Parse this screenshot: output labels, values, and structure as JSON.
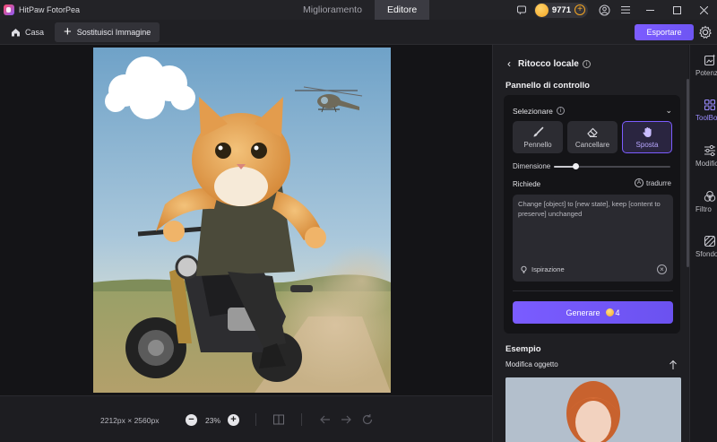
{
  "app": {
    "name": "HitPaw FotorPea"
  },
  "tabs": [
    {
      "label": "Miglioramento",
      "active": false
    },
    {
      "label": "Editore",
      "active": true
    }
  ],
  "titlebar": {
    "coins": "9771"
  },
  "toolbar": {
    "home_label": "Casa",
    "replace_label": "Sostituisci Immagine",
    "export_label": "Esportare"
  },
  "bottom": {
    "dimensions": "2212px × 2560px",
    "zoom": "23%"
  },
  "panel": {
    "header": "Ritocco locale",
    "control_title": "Pannello di controllo",
    "select_label": "Selezionare",
    "tools": [
      {
        "label": "Pennello",
        "icon": "brush-icon",
        "active": false
      },
      {
        "label": "Cancellare",
        "icon": "eraser-icon",
        "active": false
      },
      {
        "label": "Sposta",
        "icon": "hand-icon",
        "active": true
      }
    ],
    "dimension_label": "Dimensione",
    "dimension_value": 0.19,
    "requests_label": "Richiede",
    "translate_label": "tradurre",
    "prompt_text": "Change [object] to [new state], keep [content to preserve] unchanged",
    "inspiration_label": "Ispirazione",
    "generate_label": "Generare",
    "generate_cost": "4",
    "example_title": "Esempio",
    "example_subtitle": "Modifica oggetto"
  },
  "sidebar": [
    {
      "label": "Potenziamento",
      "icon": "enhance-icon",
      "active": false
    },
    {
      "label": "ToolBox",
      "icon": "toolbox-icon",
      "active": true
    },
    {
      "label": "Modifica",
      "icon": "adjust-icon",
      "active": false
    },
    {
      "label": "Filtro",
      "icon": "filter-icon",
      "active": false
    },
    {
      "label": "Sfondo",
      "icon": "background-icon",
      "active": false
    }
  ],
  "colors": {
    "accent": "#7c5cff",
    "background": "#1b1b1f",
    "panel": "#1f1f23"
  }
}
